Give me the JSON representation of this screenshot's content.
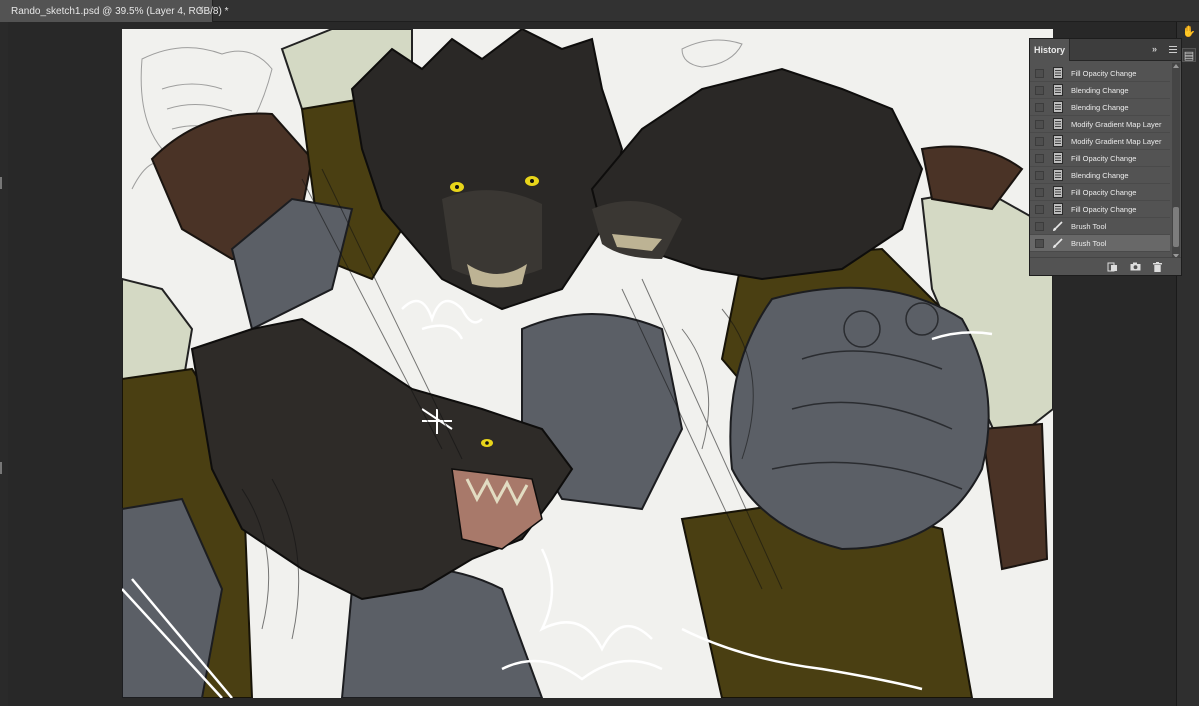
{
  "document": {
    "tab_title": "Rando_sketch1.psd @ 39.5% (Layer 4, RGB/8) *",
    "close_glyph": "×"
  },
  "history_panel": {
    "tab_label": "History",
    "collapse_glyph": "»",
    "items": [
      {
        "label": "Fill Opacity Change",
        "icon": "document-state-icon"
      },
      {
        "label": "Blending Change",
        "icon": "document-state-icon"
      },
      {
        "label": "Blending Change",
        "icon": "document-state-icon"
      },
      {
        "label": "Modify Gradient Map Layer",
        "icon": "document-state-icon"
      },
      {
        "label": "Modify Gradient Map Layer",
        "icon": "document-state-icon"
      },
      {
        "label": "Fill Opacity Change",
        "icon": "document-state-icon"
      },
      {
        "label": "Blending Change",
        "icon": "document-state-icon"
      },
      {
        "label": "Fill Opacity Change",
        "icon": "document-state-icon"
      },
      {
        "label": "Fill Opacity Change",
        "icon": "document-state-icon"
      },
      {
        "label": "Brush Tool",
        "icon": "brush-icon"
      },
      {
        "label": "Brush Tool",
        "icon": "brush-icon",
        "active": true
      }
    ],
    "footer_buttons": [
      "new-document-from-state-icon",
      "snapshot-camera-icon",
      "trash-icon"
    ]
  },
  "colors": {
    "canvas_bg": "#f1f1ee",
    "fur_dark": "#2a2826",
    "armor_gray": "#5b5f66",
    "cloak_olive": "#4a3f12",
    "eye_yellow": "#e8d51a",
    "sketch_green": "#d4d9c4",
    "leather_brown": "#4a3326"
  }
}
